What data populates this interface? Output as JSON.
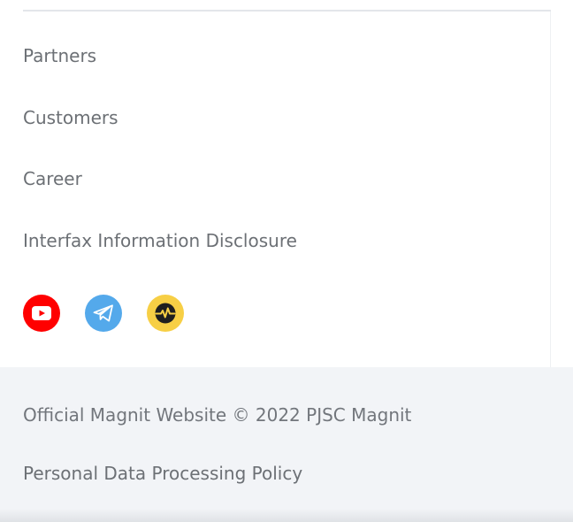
{
  "nav": {
    "items": [
      {
        "label": "Partners"
      },
      {
        "label": "Customers"
      },
      {
        "label": "Career"
      },
      {
        "label": "Interfax Information Disclosure"
      }
    ]
  },
  "social": {
    "items": [
      {
        "icon": "youtube-icon",
        "color": "#ff0000"
      },
      {
        "icon": "telegram-icon",
        "color": "#54a9eb"
      },
      {
        "icon": "pulse-icon",
        "color": "#f7cf45"
      }
    ]
  },
  "footer": {
    "copyright": "Official Magnit Website © 2022 PJSC Magnit",
    "policy": "Personal Data Processing Policy"
  }
}
